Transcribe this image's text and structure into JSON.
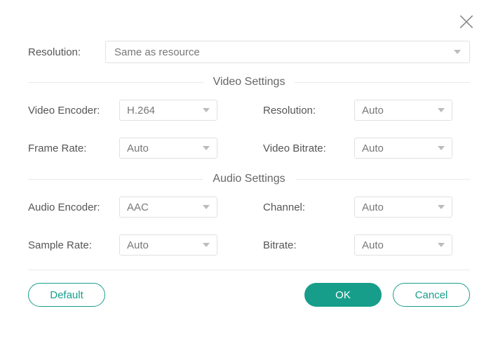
{
  "header": {
    "close_icon": "close"
  },
  "top": {
    "resolution_label": "Resolution:",
    "resolution_value": "Same as resource"
  },
  "video_section": {
    "title": "Video Settings",
    "video_encoder_label": "Video Encoder:",
    "video_encoder_value": "H.264",
    "resolution_label": "Resolution:",
    "resolution_value": "Auto",
    "frame_rate_label": "Frame Rate:",
    "frame_rate_value": "Auto",
    "video_bitrate_label": "Video Bitrate:",
    "video_bitrate_value": "Auto"
  },
  "audio_section": {
    "title": "Audio Settings",
    "audio_encoder_label": "Audio Encoder:",
    "audio_encoder_value": "AAC",
    "channel_label": "Channel:",
    "channel_value": "Auto",
    "sample_rate_label": "Sample Rate:",
    "sample_rate_value": "Auto",
    "bitrate_label": "Bitrate:",
    "bitrate_value": "Auto"
  },
  "footer": {
    "default_label": "Default",
    "ok_label": "OK",
    "cancel_label": "Cancel"
  },
  "colors": {
    "accent": "#179e8b"
  }
}
